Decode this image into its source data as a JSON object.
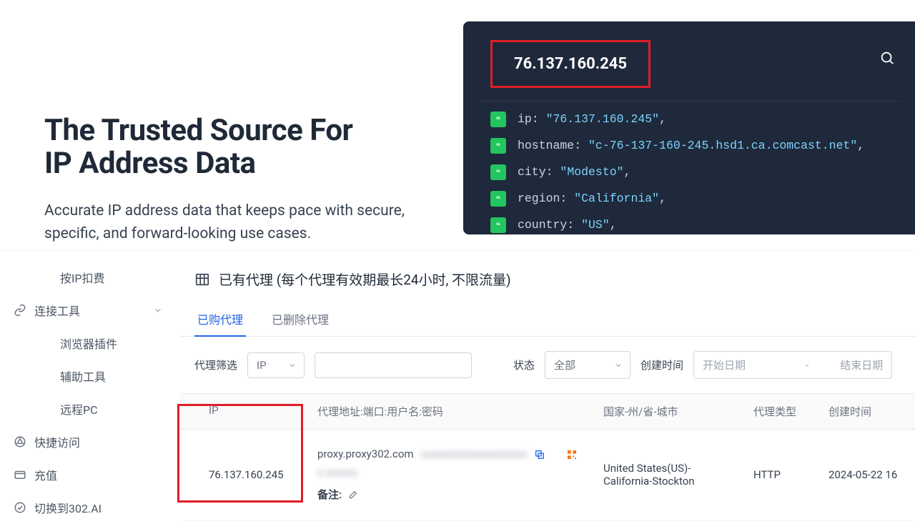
{
  "hero": {
    "title_line1": "The Trusted Source For",
    "title_line2": "IP Address Data",
    "subtitle": "Accurate IP address data that keeps pace with secure, specific, and forward-looking use cases."
  },
  "lookup": {
    "search_ip": "76.137.160.245",
    "kv": [
      {
        "key": "ip",
        "value": "\"76.137.160.245\""
      },
      {
        "key": "hostname",
        "value": "\"c-76-137-160-245.hsd1.ca.comcast.net\""
      },
      {
        "key": "city",
        "value": "\"Modesto\""
      },
      {
        "key": "region",
        "value": "\"California\""
      },
      {
        "key": "country",
        "value": "\"US\""
      }
    ]
  },
  "sidebar": {
    "items": [
      {
        "label": "按IP扣费",
        "icon": null,
        "indent": true
      },
      {
        "label": "连接工具",
        "icon": "link",
        "chevron": true
      },
      {
        "label": "浏览器插件",
        "icon": null,
        "indent": true
      },
      {
        "label": "辅助工具",
        "icon": null,
        "indent": true
      },
      {
        "label": "远程PC",
        "icon": null,
        "indent": true
      },
      {
        "label": "快捷访问",
        "icon": "chrome"
      },
      {
        "label": "充值",
        "icon": "wallet"
      },
      {
        "label": "切换到302.AI",
        "icon": "switch"
      }
    ]
  },
  "main": {
    "header": "已有代理 (每个代理有效期最长24小时, 不限流量)",
    "tabs": [
      {
        "label": "已购代理",
        "active": true
      },
      {
        "label": "已删除代理",
        "active": false
      }
    ],
    "filters": {
      "filter_label": "代理筛选",
      "ip_label": "IP",
      "status_label": "状态",
      "status_value": "全部",
      "created_label": "创建时间",
      "start_placeholder": "开始日期",
      "end_placeholder": "结束日期",
      "dash": "-"
    },
    "table": {
      "headers": {
        "ip": "IP",
        "addr": "代理地址:端口:用户名:密码",
        "loc": "国家-州/省-城市",
        "type": "代理类型",
        "ctime": "创建时间"
      },
      "row": {
        "ip": "76.137.160.245",
        "addr_visible": "proxy.proxy302.com",
        "addr_blur1": "xxxxxxxxxxxxxxxxxxxx",
        "addr_blur2": "x xxxxxx",
        "remark_label": "备注:",
        "loc": "United States(US)-California-Stockton",
        "type": "HTTP",
        "ctime": "2024-05-22 16"
      }
    }
  }
}
